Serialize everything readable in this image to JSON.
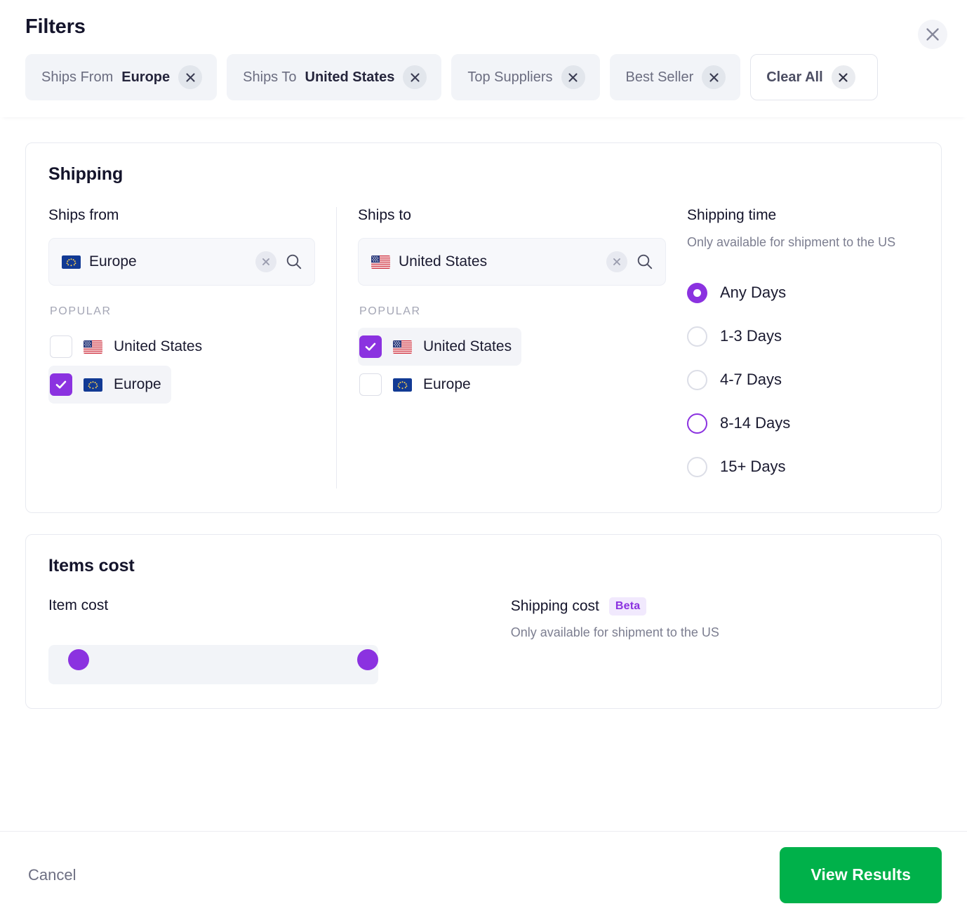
{
  "header": {
    "title": "Filters",
    "close_icon": "close-icon",
    "chips": [
      {
        "label": "Ships From",
        "value": "Europe",
        "style": "filled"
      },
      {
        "label": "Ships To",
        "value": "United States",
        "style": "filled"
      },
      {
        "label": "Top Suppliers",
        "value": "",
        "style": "filled"
      },
      {
        "label": "Best Seller",
        "value": "",
        "style": "filled"
      },
      {
        "label": "Clear All",
        "value": "",
        "style": "outlined"
      }
    ]
  },
  "shipping": {
    "title": "Shipping",
    "ships_from": {
      "heading": "Ships from",
      "search_value": "Europe",
      "search_flag": "eu-flag-icon",
      "clear_icon": "clear-icon",
      "search_icon": "search-icon",
      "popular_label": "POPULAR",
      "options": [
        {
          "label": "United States",
          "flag": "us-flag-icon",
          "checked": false
        },
        {
          "label": "Europe",
          "flag": "eu-flag-icon",
          "checked": true
        }
      ]
    },
    "ships_to": {
      "heading": "Ships to",
      "search_value": "United States",
      "search_flag": "us-flag-icon",
      "clear_icon": "clear-icon",
      "search_icon": "search-icon",
      "popular_label": "POPULAR",
      "options": [
        {
          "label": "United States",
          "flag": "us-flag-icon",
          "checked": true
        },
        {
          "label": "Europe",
          "flag": "eu-flag-icon",
          "checked": false
        }
      ]
    },
    "shipping_time": {
      "heading": "Shipping time",
      "note": "Only available for shipment to the US",
      "options": [
        {
          "label": "Any Days",
          "state": "selected"
        },
        {
          "label": "1-3 Days",
          "state": "default"
        },
        {
          "label": "4-7 Days",
          "state": "default"
        },
        {
          "label": "8-14 Days",
          "state": "hovered"
        },
        {
          "label": "15+ Days",
          "state": "default"
        }
      ]
    }
  },
  "items_cost": {
    "title": "Items cost",
    "item_cost": {
      "heading": "Item cost"
    },
    "shipping_cost": {
      "heading": "Shipping cost",
      "badge": "Beta",
      "note": "Only available for shipment to the US"
    }
  },
  "footer": {
    "cancel_label": "Cancel",
    "view_results_label": "View Results"
  },
  "colors": {
    "accent_purple": "#8B32E0",
    "primary_green": "#00b14a",
    "chip_bg": "#f2f4f8",
    "text_dark": "#14142b",
    "text_muted": "#7c7e90"
  }
}
